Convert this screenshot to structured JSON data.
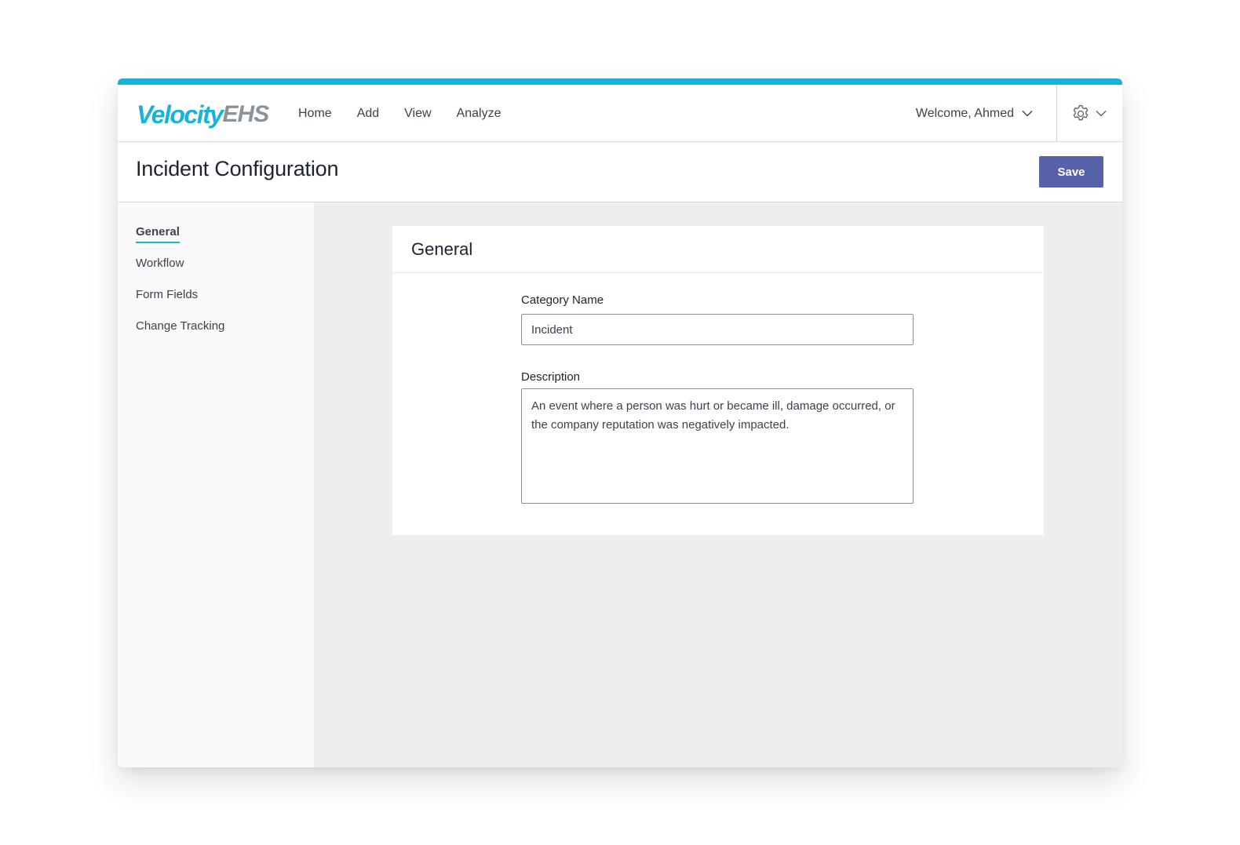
{
  "app": {
    "logo_primary": "Velocity",
    "logo_secondary": "EHS",
    "accent_color": "#19b2d9",
    "button_color": "#5661a8"
  },
  "nav": {
    "items": [
      {
        "label": "Home"
      },
      {
        "label": "Add"
      },
      {
        "label": "View"
      },
      {
        "label": "Analyze"
      }
    ],
    "welcome": "Welcome, Ahmed"
  },
  "header": {
    "title": "Incident Configuration",
    "save_label": "Save"
  },
  "sidebar": {
    "items": [
      {
        "label": "General",
        "active": true
      },
      {
        "label": "Workflow"
      },
      {
        "label": "Form Fields"
      },
      {
        "label": "Change Tracking"
      }
    ]
  },
  "card": {
    "title": "General",
    "category_label": "Category Name",
    "category_value": "Incident",
    "description_label": "Description",
    "description_value": "An event where a person was hurt or became ill, damage occurred, or the company reputation was negatively impacted."
  }
}
